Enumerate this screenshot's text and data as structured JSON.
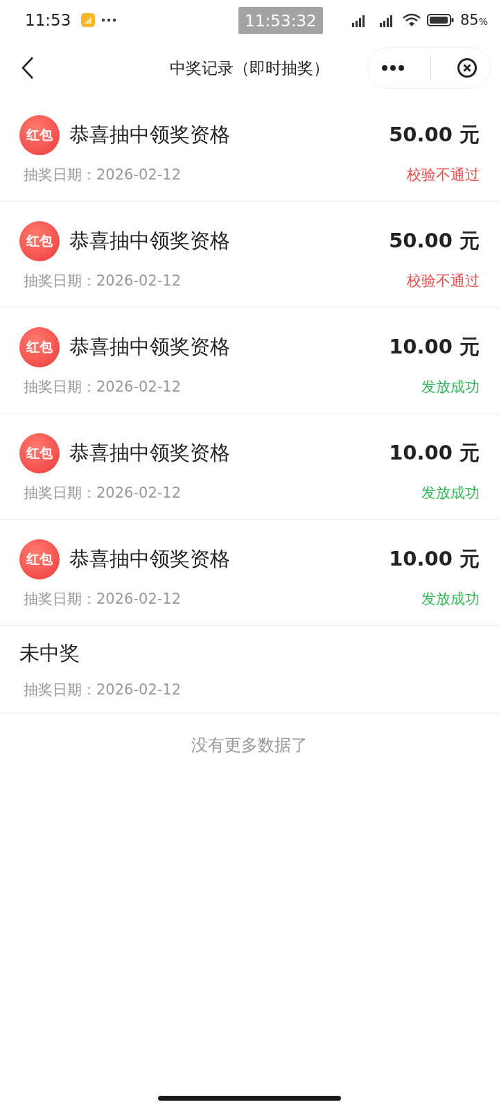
{
  "status_bar": {
    "time": "11:53",
    "overlay_time": "11:53:32",
    "battery": "85",
    "battery_unit": "%"
  },
  "nav": {
    "title": "中奖记录（即时抽奖）"
  },
  "records": [
    {
      "kind": "prize",
      "badge": "红包",
      "title": "恭喜抽中领奖资格",
      "amount": "50.00 元",
      "date": "抽奖日期：2026-02-12",
      "status": "校验不通过",
      "color": "#ec4d4d"
    },
    {
      "kind": "prize",
      "badge": "红包",
      "title": "恭喜抽中领奖资格",
      "amount": "50.00 元",
      "date": "抽奖日期：2026-02-12",
      "status": "校验不通过",
      "color": "#ec4d4d"
    },
    {
      "kind": "prize",
      "badge": "红包",
      "title": "恭喜抽中领奖资格",
      "amount": "10.00 元",
      "date": "抽奖日期：2026-02-12",
      "status": "发放成功",
      "color": "#2fba55"
    },
    {
      "kind": "prize",
      "badge": "红包",
      "title": "恭喜抽中领奖资格",
      "amount": "10.00 元",
      "date": "抽奖日期：2026-02-12",
      "status": "发放成功",
      "color": "#2fba55"
    },
    {
      "kind": "prize",
      "badge": "红包",
      "title": "恭喜抽中领奖资格",
      "amount": "10.00 元",
      "date": "抽奖日期：2026-02-12",
      "status": "发放成功",
      "color": "#2fba55"
    },
    {
      "kind": "none",
      "title": "未中奖",
      "date": "抽奖日期：2026-02-12"
    }
  ],
  "footer": "没有更多数据了"
}
